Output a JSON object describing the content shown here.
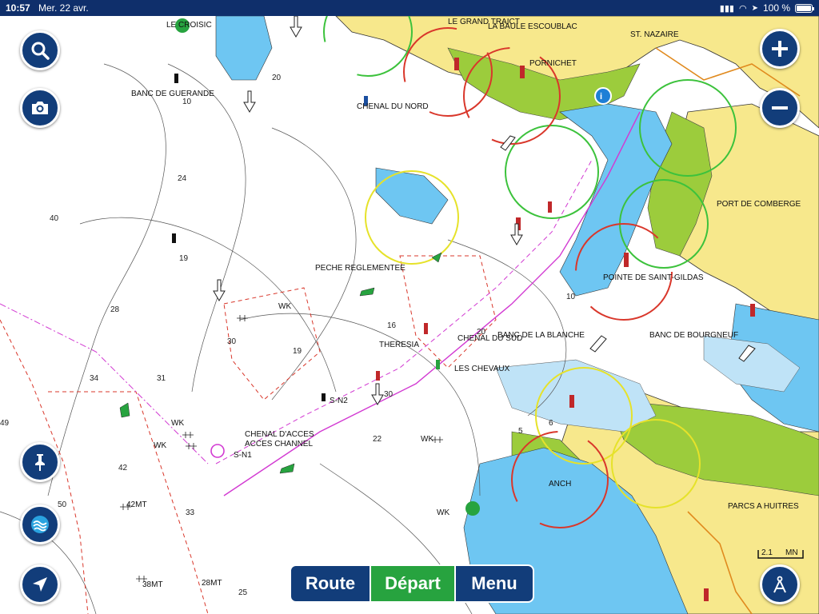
{
  "status_bar": {
    "time": "10:57",
    "date": "Mer. 22 avr.",
    "battery": "100 %"
  },
  "map_labels": {
    "le_croisic": "LE CROISIC",
    "le_grand_traict": "LE GRAND TRAICT",
    "la_baule": "LA BAULE ESCOUBLAC",
    "st_nazaire": "ST. NAZAIRE",
    "pornichet": "PORNICHET",
    "banc_guerande": "BANC DE GUERANDE",
    "chenal_nord": "CHENAL DU NORD",
    "port_comberge": "PORT DE COMBERGE",
    "peche": "PECHE REGLEMENTEE",
    "pointe_st_gildas": "POINTE DE SAINT-GILDAS",
    "wk1": "WK",
    "theresia": "THERESIA",
    "chenal_sud": "CHENAL DU SUD",
    "banc_blanche": "BANC DE LA BLANCHE",
    "banc_bourgneuf": "BANC DE BOURGNEUF",
    "les_chevaux": "LES CHEVAUX",
    "sn2": "S-N2",
    "chenal_acces": "CHENAL D'ACCES",
    "acces_channel": "ACCES CHANNEL",
    "sn1": "S-N1",
    "wk2": "WK",
    "wk3": "WK",
    "wk4": "WK",
    "wk5": "WK",
    "parcs_huitres": "PARCS A HUITRES",
    "anch": "ANCH",
    "mt42": "42MT",
    "mt38": "38MT",
    "mt28": "28MT"
  },
  "depths": [
    "20",
    "10",
    "24",
    "40",
    "19",
    "28",
    "30",
    "34",
    "31",
    "49",
    "42",
    "33",
    "50",
    "22",
    "30",
    "16",
    "19",
    "20",
    "10",
    "25",
    "5",
    "6"
  ],
  "controls": {
    "zoom_in": "zoom-in",
    "zoom_out": "zoom-out",
    "search": "search",
    "camera": "camera",
    "pin": "pin",
    "layers": "layers",
    "locate": "locate",
    "compass": "compass"
  },
  "bottom_nav": {
    "route": "Route",
    "depart": "Départ",
    "menu": "Menu"
  },
  "scale": {
    "value": "2.1",
    "unit": "MN"
  },
  "colors": {
    "land": "#f7e88c",
    "shallow": "#6ec6f2",
    "medium": "#bfe3f7",
    "drying": "#9ccc3c",
    "accent": "#123d7a",
    "depart": "#27a33f"
  }
}
